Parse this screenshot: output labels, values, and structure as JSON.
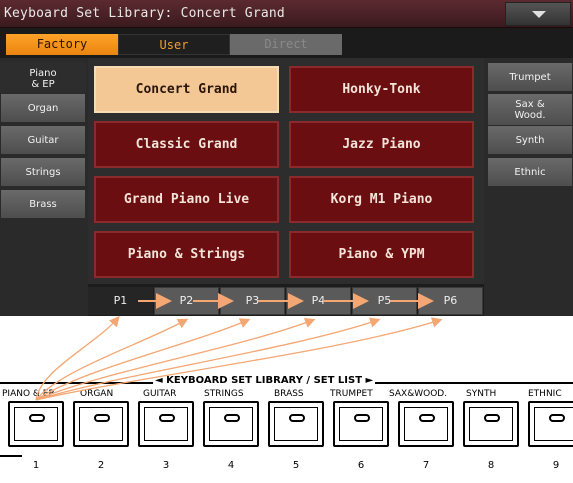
{
  "window": {
    "title": "Keyboard Set Library: Concert Grand",
    "menu_icon": "triangle-down-icon"
  },
  "bank_tabs": [
    {
      "label": "Factory",
      "state": "selected"
    },
    {
      "label": "User",
      "state": "normal"
    },
    {
      "label": "Direct",
      "state": "disabled"
    }
  ],
  "left_tabs": [
    {
      "label": "Piano\n& EP",
      "selected": true
    },
    {
      "label": "Organ"
    },
    {
      "label": "Guitar"
    },
    {
      "label": "Strings"
    },
    {
      "label": "Brass"
    }
  ],
  "right_tabs": [
    {
      "label": "Trumpet"
    },
    {
      "label": "Sax &\nWood."
    },
    {
      "label": "Synth"
    },
    {
      "label": "Ethnic"
    }
  ],
  "sounds": [
    {
      "label": "Concert Grand",
      "selected": true
    },
    {
      "label": "Honky-Tonk"
    },
    {
      "label": "Classic Grand"
    },
    {
      "label": "Jazz Piano"
    },
    {
      "label": "Grand Piano Live"
    },
    {
      "label": "Korg M1 Piano"
    },
    {
      "label": "Piano & Strings"
    },
    {
      "label": "Piano & YPM"
    }
  ],
  "pages": [
    {
      "label": "P1",
      "selected": true
    },
    {
      "label": "P2"
    },
    {
      "label": "P3"
    },
    {
      "label": "P4"
    },
    {
      "label": "P5"
    },
    {
      "label": "P6"
    }
  ],
  "set_list": {
    "title": "◄ KEYBOARD SET LIBRARY / SET LIST ►",
    "categories": [
      "PIANO & EP",
      "ORGAN",
      "GUITAR",
      "STRINGS",
      "BRASS",
      "TRUMPET",
      "SAX&WOOD.",
      "SYNTH",
      "ETHNIC"
    ],
    "key_numbers": [
      "1",
      "2",
      "3",
      "4",
      "5",
      "6",
      "7",
      "8",
      "9"
    ]
  },
  "colors": {
    "title_bar": "#4a2026",
    "factory_tab": "#f39419",
    "sound_button": "#6b0e12",
    "selected_sound": "#f3c895",
    "arrow": "#f4a673"
  }
}
